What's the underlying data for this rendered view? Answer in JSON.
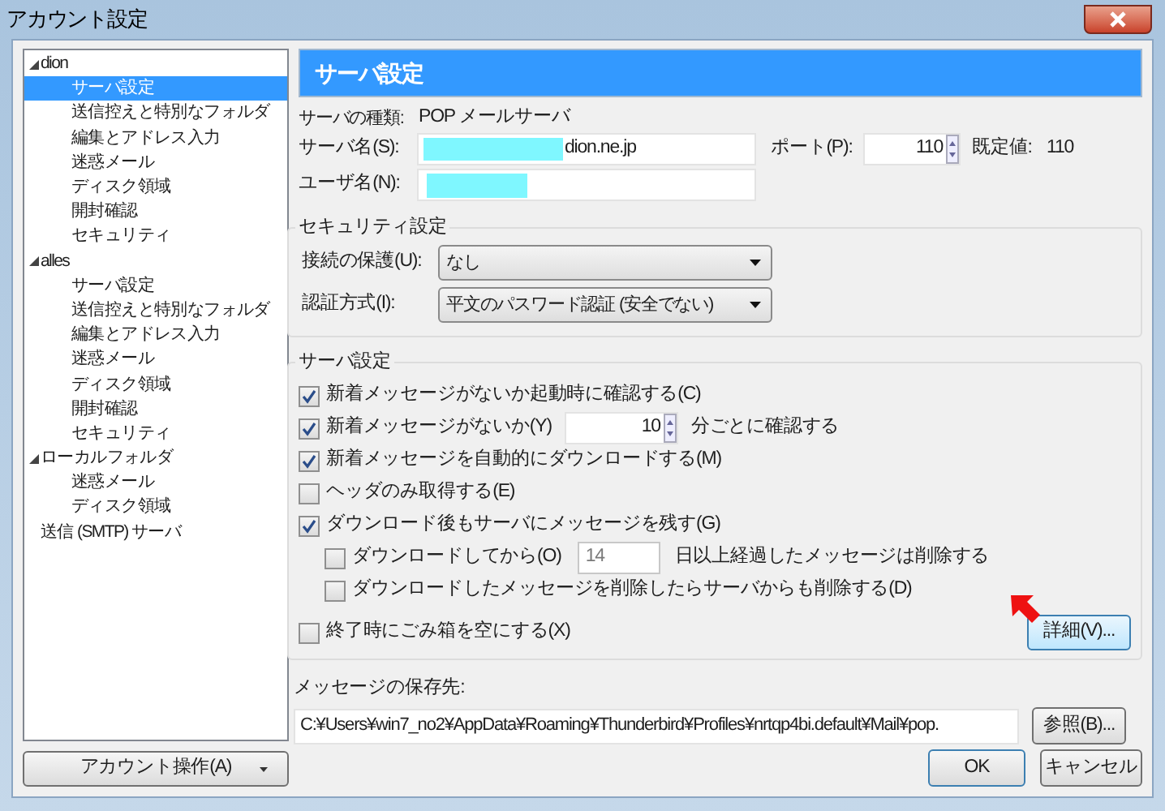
{
  "window": {
    "title": "アカウント設定"
  },
  "tree": [
    {
      "label": "dion",
      "expanded": true,
      "children": [
        {
          "label": "サーバ設定",
          "selected": true
        },
        {
          "label": "送信控えと特別なフォルダ",
          "selected": false
        },
        {
          "label": "編集とアドレス入力",
          "selected": false
        },
        {
          "label": "迷惑メール",
          "selected": false
        },
        {
          "label": "ディスク領域",
          "selected": false
        },
        {
          "label": "開封確認",
          "selected": false
        },
        {
          "label": "セキュリティ",
          "selected": false
        }
      ]
    },
    {
      "label": "alles",
      "expanded": true,
      "children": [
        {
          "label": "サーバ設定",
          "selected": false
        },
        {
          "label": "送信控えと特別なフォルダ",
          "selected": false
        },
        {
          "label": "編集とアドレス入力",
          "selected": false
        },
        {
          "label": "迷惑メール",
          "selected": false
        },
        {
          "label": "ディスク領域",
          "selected": false
        },
        {
          "label": "開封確認",
          "selected": false
        },
        {
          "label": "セキュリティ",
          "selected": false
        }
      ]
    },
    {
      "label": "ローカルフォルダ",
      "expanded": true,
      "children": [
        {
          "label": "迷惑メール",
          "selected": false
        },
        {
          "label": "ディスク領域",
          "selected": false
        }
      ]
    },
    {
      "label": "送信 (SMTP) サーバ"
    }
  ],
  "account_actions": {
    "label": "アカウント操作(A)"
  },
  "header": "サーバ設定",
  "server_type": {
    "label": "サーバの種類:",
    "value": "POP メールサーバ"
  },
  "server_name": {
    "label": "サーバ名(S):",
    "value": "dion.ne.jp",
    "redacted": true
  },
  "port": {
    "label": "ポート(P):",
    "value": "110",
    "default_label": "既定値:",
    "default_value": "110"
  },
  "user_name": {
    "label": "ユーザ名(N):",
    "redacted": true
  },
  "security": {
    "title": "セキュリティ設定",
    "selects": [
      {
        "label": "接続の保護(U):",
        "value": "なし"
      },
      {
        "label": "認証方式(I):",
        "value": "平文のパスワード認証 (安全でない)"
      }
    ]
  },
  "server_settings": {
    "title": "サーバ設定",
    "options": [
      {
        "kind": "check",
        "label": "新着メッセージがないか起動時に確認する(C)",
        "checked": true
      },
      {
        "kind": "interval",
        "label": "新着メッセージがないか(Y)",
        "checked": true,
        "value": "10",
        "suffix": "分ごとに確認する"
      },
      {
        "kind": "check",
        "label": "新着メッセージを自動的にダウンロードする(M)",
        "checked": true
      },
      {
        "kind": "check",
        "label": "ヘッダのみ取得する(E)",
        "checked": false
      },
      {
        "kind": "check",
        "label": "ダウンロード後もサーバにメッセージを残す(G)",
        "checked": true,
        "children": [
          {
            "kind": "days",
            "label": "ダウンロードしてから(O)",
            "checked": false,
            "value": "14",
            "disabled": true,
            "suffix": "日以上経過したメッセージは削除する"
          },
          {
            "kind": "check",
            "label": "ダウンロードしたメッセージを削除したらサーバからも削除する(D)",
            "checked": false
          }
        ]
      }
    ],
    "empty_trash": {
      "label": "終了時にごみ箱を空にする(X)",
      "checked": false
    },
    "details_button": {
      "label": "詳細(V)...",
      "pointer_arrow": true
    }
  },
  "storage": {
    "label": "メッセージの保存先:",
    "value": "C:¥Users¥win7_no2¥AppData¥Roaming¥Thunderbird¥Profiles¥nrtqp4bi.default¥Mail¥pop.",
    "browse": "参照(B)..."
  },
  "buttons": [
    "OK",
    "キャンセル"
  ]
}
